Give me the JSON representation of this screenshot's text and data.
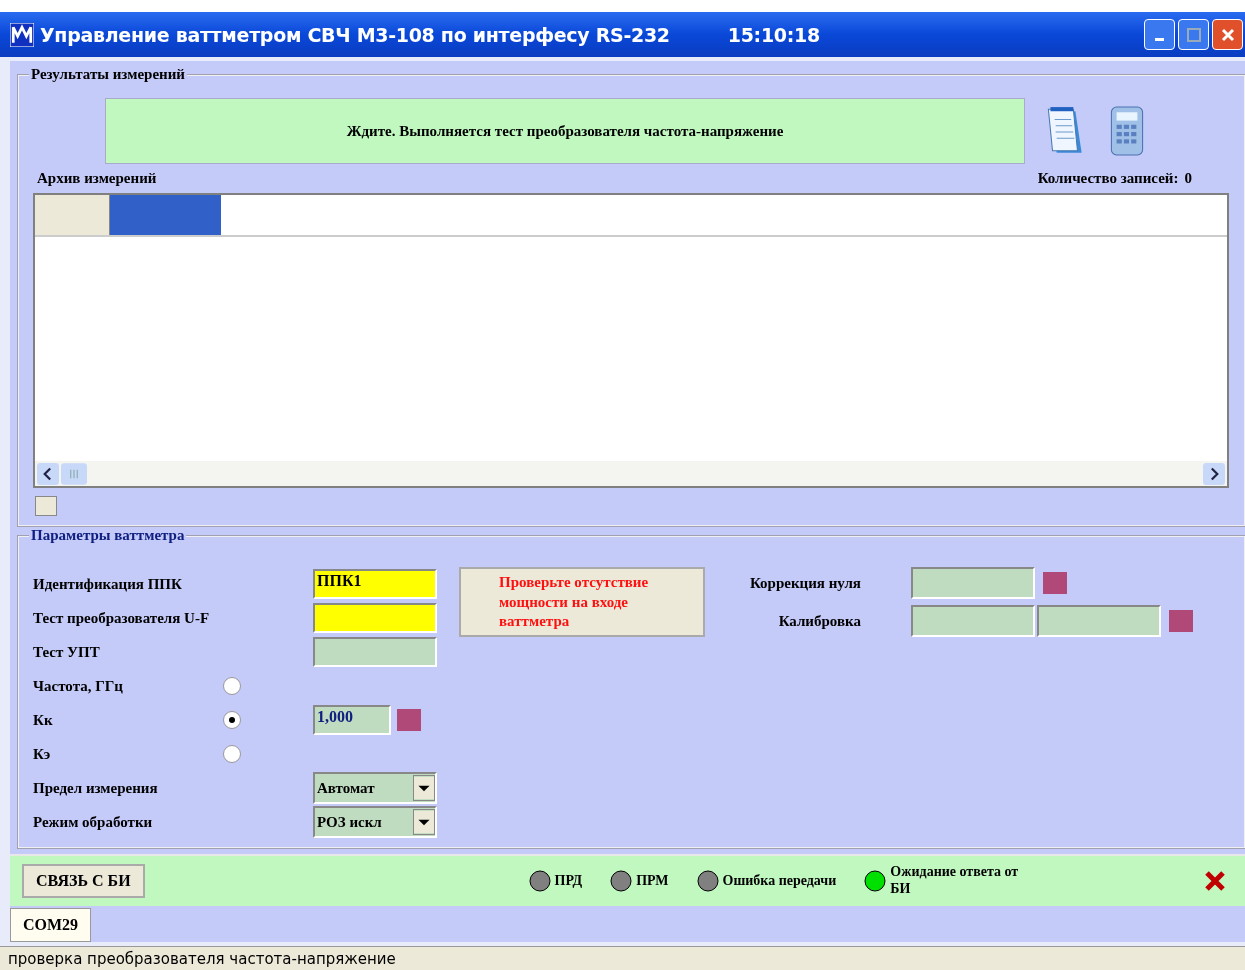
{
  "window": {
    "title": "Управление ваттметром СВЧ М3-108 по интерфесу RS-232",
    "clock": "15:10:18"
  },
  "results": {
    "title": "Результаты измерений",
    "message": "Ждите. Выполняется тест преобразователя частота-напряжение",
    "archive_label": "Архив измерений",
    "count_label": "Количество записей:",
    "count": "0"
  },
  "params": {
    "title": "Параметры ваттметра",
    "rows": [
      {
        "kind": "field",
        "label": "Идентификация ППК",
        "value": "ППК1",
        "highlighted": true
      },
      {
        "kind": "field",
        "label": "Тест преобразователя U-F",
        "highlighted": true
      },
      {
        "kind": "field",
        "label": "Тест УПТ",
        "highlighted": false
      },
      {
        "kind": "radio",
        "label": "Частота, ГГц",
        "selected": false
      },
      {
        "kind": "radio",
        "label": "Кк",
        "selected": true,
        "value": "1,000"
      },
      {
        "kind": "radio",
        "label": "Кэ",
        "selected": false
      },
      {
        "kind": "select",
        "label": "Предел измерения",
        "value": "Автомат"
      },
      {
        "kind": "select",
        "label": "Режим обработки",
        "value": "РОЗ искл"
      }
    ],
    "warning": "Проверьте отсутствие мощности на входе ваттметра",
    "zero_correction": {
      "label": "Коррекция нуля"
    },
    "calibration": {
      "label": "Калибровка"
    }
  },
  "bottom": {
    "connect_button": "СВЯЗЬ С БИ",
    "indicators": [
      {
        "label": "ПРД",
        "color": "#808080"
      },
      {
        "label": "ПРМ",
        "color": "#808080"
      },
      {
        "label": "Ошибка передачи",
        "color": "#808080"
      },
      {
        "label": "Ожидание ответа от БИ",
        "color": "#00e000"
      }
    ]
  },
  "tabs": [
    {
      "label": "COM29",
      "selected": true
    }
  ],
  "status_bar": "проверка преобразователя частота-напряжение"
}
